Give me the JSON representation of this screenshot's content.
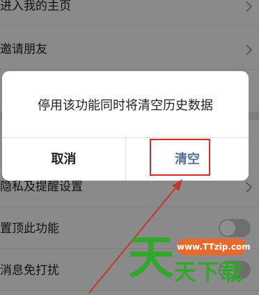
{
  "settings": {
    "rows": [
      {
        "label": "进入我的主页"
      },
      {
        "label": "邀请朋友"
      },
      {
        "label": "隐私及提醒设置"
      },
      {
        "label": "置顶此功能"
      },
      {
        "label": "消息免打扰"
      }
    ]
  },
  "dialog": {
    "message": "停用该功能同时将清空历史数据",
    "cancel_label": "取消",
    "confirm_label": "清空"
  },
  "watermark": {
    "url": "www.TTzip.com",
    "big_char": "天",
    "rest_text": "天下载"
  },
  "colors": {
    "confirm": "#5a6f9a",
    "highlight": "#d42a2a",
    "watermark_green": "#2fa82b",
    "watermark_orange": "#e76a2a"
  }
}
